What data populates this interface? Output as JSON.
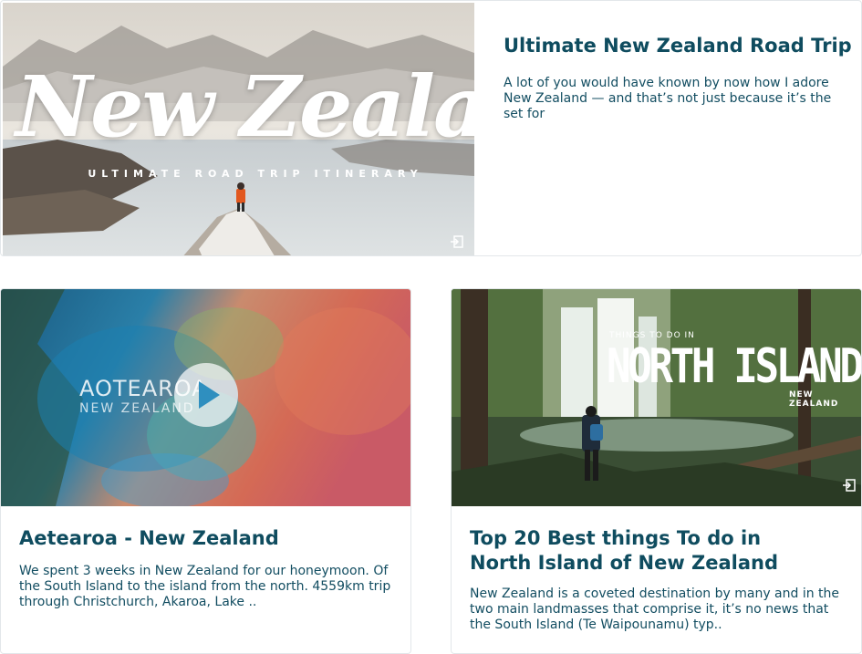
{
  "posts": [
    {
      "thumb_headline": "New Zealand",
      "thumb_subline": "ULTIMATE ROAD TRIP ITINERARY",
      "title": "Ultimate New Zealand Road Trip",
      "excerpt": "A lot of you would have known by now how I adore New Zealand — and that’s not just because it’s the set for",
      "icon": "external-link-icon"
    },
    {
      "thumb_headline": "AOTEAROA",
      "thumb_subline": "NEW ZEALAND",
      "title": "Aetearoa - New Zealand",
      "excerpt": "We spent 3 weeks in New Zealand for our honeymoon. Of the South Island to the island from the north. 4559km trip through Christchurch, Akaroa, Lake ..",
      "icon": "play-icon"
    },
    {
      "thumb_kicker": "THINGS TO DO IN",
      "thumb_headline": "NORTH ISLAND",
      "thumb_subline": "NEW ZEALAND",
      "title_line1": "Top 20 Best things To do in",
      "title_line2": "North Island of New Zealand",
      "excerpt": "New Zealand is a coveted destination by many and in the two main landmasses that comprise it, it’s no news that the South Island (Te Waipounamu) typ..",
      "icon": "external-link-icon"
    }
  ],
  "colors": {
    "title": "#0f4c5f",
    "text": "#124d61",
    "border": "#e3e7ea"
  }
}
